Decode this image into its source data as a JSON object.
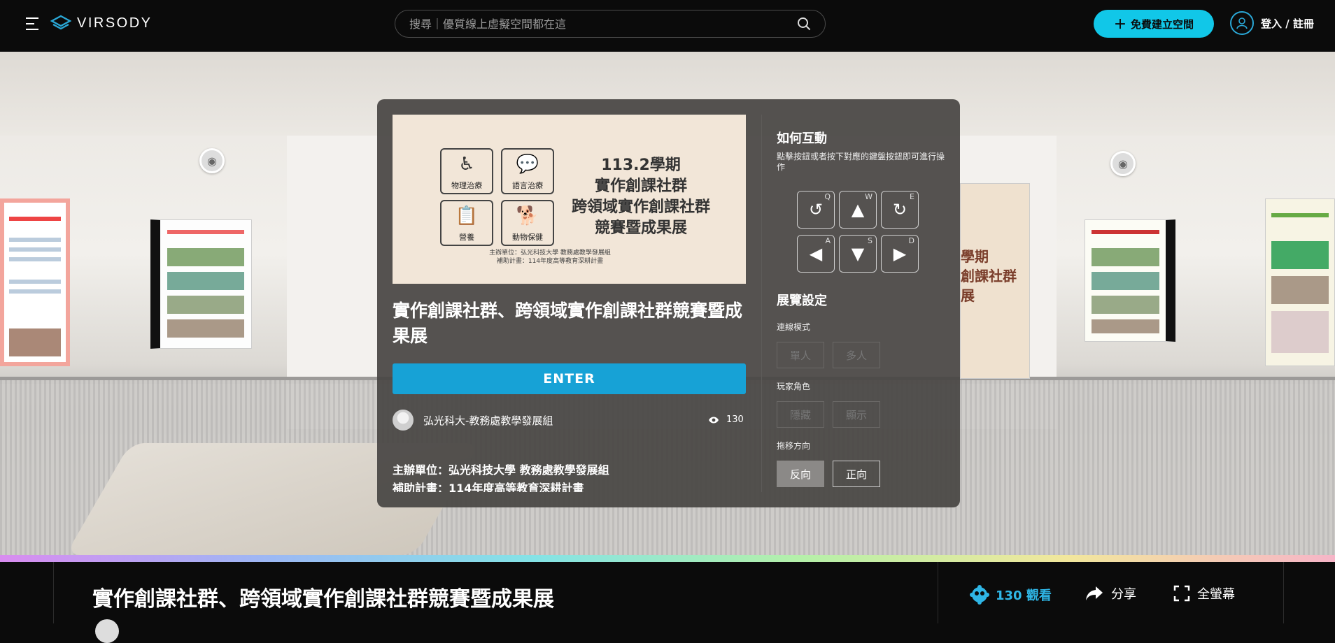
{
  "header": {
    "logo_text": "VIRSODY",
    "search_placeholder": "搜尋｜優質線上虛擬空間都在這",
    "create_label": "免費建立空間",
    "login_label": "登入 / 註冊"
  },
  "scene": {
    "poster_right_text": "學期\n創課社群\n展"
  },
  "modal": {
    "cover": {
      "icons": [
        {
          "label": "物理治療",
          "icon": "therapy-icon"
        },
        {
          "label": "語言治療",
          "icon": "speech-bubble-icon"
        },
        {
          "label": "營養",
          "icon": "clipboard-apple-icon"
        },
        {
          "label": "動物保健",
          "icon": "dog-icon"
        }
      ],
      "title_lines": [
        "113.2學期",
        "實作創課社群",
        "跨領域實作創課社群",
        "競賽暨成果展"
      ],
      "footer_lines": [
        "主辦單位：弘光科技大學 教務處教學發展組",
        "補助計畫：114年度高等教育深耕計畫"
      ]
    },
    "title": "實作創課社群、跨領域實作創課社群競賽暨成果展",
    "enter_label": "ENTER",
    "author": "弘光科大-教務處教學發展組",
    "views": "130",
    "description": "主辦單位：弘光科技大學 教務處教學發展組\n補助計畫：114年度高等教育深耕計畫",
    "interaction": {
      "heading": "如何互動",
      "hint": "點擊按鈕或者按下對應的鍵盤按鈕即可進行操作",
      "keys": [
        {
          "key": "Q",
          "icon": "rotate-left-icon",
          "glyph": "↺"
        },
        {
          "key": "W",
          "icon": "arrow-up-icon",
          "glyph": "▲"
        },
        {
          "key": "E",
          "icon": "rotate-right-icon",
          "glyph": "↻"
        },
        {
          "key": "A",
          "icon": "arrow-left-icon",
          "glyph": "◀"
        },
        {
          "key": "S",
          "icon": "arrow-down-icon",
          "glyph": "▼"
        },
        {
          "key": "D",
          "icon": "arrow-right-icon",
          "glyph": "▶"
        }
      ]
    },
    "settings": {
      "heading": "展覽設定",
      "connection_label": "連線模式",
      "connection_options": [
        "單人",
        "多人"
      ],
      "role_label": "玩家角色",
      "role_options": [
        "隱藏",
        "顯示"
      ],
      "drag_label": "拖移方向",
      "drag_options": [
        "反向",
        "正向"
      ],
      "drag_selected": "反向"
    }
  },
  "bottom": {
    "title": "實作創課社群、跨領域實作創課社群競賽暨成果展",
    "views_label": "130 觀看",
    "share_label": "分享",
    "fullscreen_label": "全螢幕"
  },
  "colors": {
    "accent": "#11c7e8",
    "enter": "#17a2d6",
    "views_text": "#2fb6e6"
  }
}
